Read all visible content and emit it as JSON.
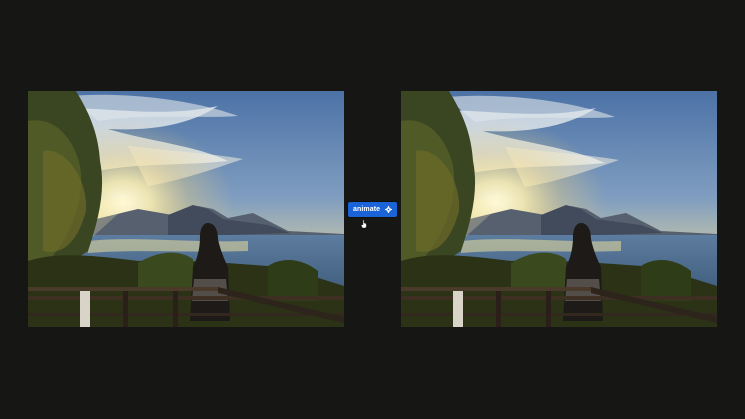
{
  "toolbar": {
    "animate_label": "animate",
    "animate_icon": "gear-icon",
    "accent_color": "#1a63d8"
  },
  "panels": [
    {
      "id": "original-photo",
      "content": "sunset-lake-photo"
    },
    {
      "id": "animated-photo",
      "content": "sunset-lake-photo"
    }
  ],
  "colors": {
    "background": "#161614",
    "sky_top": "#4f74a8",
    "sun": "#fff6c8"
  },
  "cursor": "hand-pointer-icon"
}
